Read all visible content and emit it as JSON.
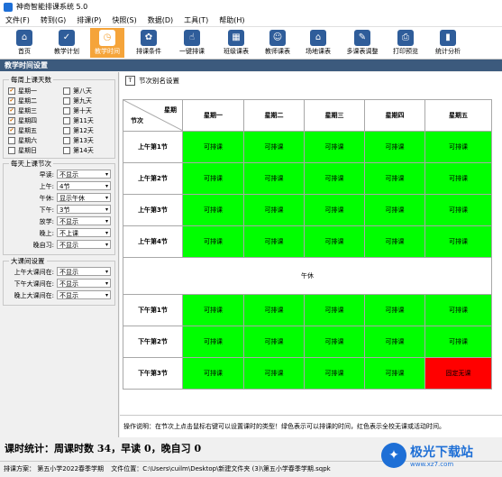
{
  "window": {
    "title": "神奇智能排课系统 5.0"
  },
  "menu": [
    "文件(F)",
    "转到(G)",
    "排课(P)",
    "快照(S)",
    "数据(D)",
    "工具(T)",
    "帮助(H)"
  ],
  "toolbar": [
    {
      "label": "首页",
      "icon": "home-icon",
      "glyph": "⌂"
    },
    {
      "label": "教学计划",
      "icon": "clipboard-icon",
      "glyph": "✓"
    },
    {
      "label": "教学时间",
      "icon": "clock-icon",
      "glyph": "◷",
      "active": true
    },
    {
      "label": "排课条件",
      "icon": "circles-icon",
      "glyph": "✿"
    },
    {
      "label": "一键排课",
      "icon": "hand-icon",
      "glyph": "☝"
    },
    {
      "label": "班级课表",
      "icon": "grid-icon",
      "glyph": "▦"
    },
    {
      "label": "教师课表",
      "icon": "teacher-icon",
      "glyph": "☺"
    },
    {
      "label": "场地课表",
      "icon": "building-icon",
      "glyph": "⌂"
    },
    {
      "label": "多课表调整",
      "icon": "adjust-icon",
      "glyph": "✎"
    },
    {
      "label": "打印预览",
      "icon": "print-icon",
      "glyph": "⎙"
    },
    {
      "label": "统计分析",
      "icon": "chart-icon",
      "glyph": "▮"
    }
  ],
  "section_title": "教学时间设置",
  "days_group": {
    "title": "每周上课天数",
    "left": [
      {
        "label": "星期一",
        "checked": true
      },
      {
        "label": "星期二",
        "checked": true
      },
      {
        "label": "星期三",
        "checked": true
      },
      {
        "label": "星期四",
        "checked": true
      },
      {
        "label": "星期五",
        "checked": true
      },
      {
        "label": "星期六",
        "checked": false
      },
      {
        "label": "星期日",
        "checked": false
      }
    ],
    "right": [
      {
        "label": "第八天",
        "checked": false
      },
      {
        "label": "第九天",
        "checked": false
      },
      {
        "label": "第十天",
        "checked": false
      },
      {
        "label": "第11天",
        "checked": false
      },
      {
        "label": "第12天",
        "checked": false
      },
      {
        "label": "第13天",
        "checked": false
      },
      {
        "label": "第14天",
        "checked": false
      }
    ]
  },
  "periods_group": {
    "title": "每天上课节次",
    "rows": [
      {
        "label": "早读:",
        "value": "不显示"
      },
      {
        "label": "上午:",
        "value": "4节"
      },
      {
        "label": "午休:",
        "value": "显示午休"
      },
      {
        "label": "下午:",
        "value": "3节"
      },
      {
        "label": "放学:",
        "value": "不显示"
      },
      {
        "label": "晚上:",
        "value": "不上课"
      },
      {
        "label": "晚自习:",
        "value": "不显示"
      }
    ]
  },
  "break_group": {
    "title": "大课间设置",
    "rows": [
      {
        "label": "上午大课间在:",
        "value": "不显示"
      },
      {
        "label": "下午大课间在:",
        "value": "不显示"
      },
      {
        "label": "晚上大课间在:",
        "value": "不显示"
      }
    ]
  },
  "subtool": {
    "label": "节次别名设置"
  },
  "schedule": {
    "corner_top": "星期",
    "corner_bottom": "节次",
    "days": [
      "星期一",
      "星期二",
      "星期三",
      "星期四",
      "星期五"
    ],
    "noon_label": "午休",
    "rows_am": [
      {
        "label": "上午第1节",
        "cells": [
          "可排课",
          "可排课",
          "可排课",
          "可排课",
          "可排课"
        ]
      },
      {
        "label": "上午第2节",
        "cells": [
          "可排课",
          "可排课",
          "可排课",
          "可排课",
          "可排课"
        ]
      },
      {
        "label": "上午第3节",
        "cells": [
          "可排课",
          "可排课",
          "可排课",
          "可排课",
          "可排课"
        ]
      },
      {
        "label": "上午第4节",
        "cells": [
          "可排课",
          "可排课",
          "可排课",
          "可排课",
          "可排课"
        ]
      }
    ],
    "rows_pm": [
      {
        "label": "下午第1节",
        "cells": [
          "可排课",
          "可排课",
          "可排课",
          "可排课",
          "可排课"
        ]
      },
      {
        "label": "下午第2节",
        "cells": [
          "可排课",
          "可排课",
          "可排课",
          "可排课",
          "可排课"
        ]
      },
      {
        "label": "下午第3节",
        "cells": [
          "可排课",
          "可排课",
          "可排课",
          "可排课",
          "固定无课"
        ]
      }
    ],
    "colors": {
      "available": "#00ff00",
      "blocked": "#ff0000"
    }
  },
  "hint": "操作说明：在节次上点击鼠标右键可以设置课时的类型！绿色表示可以排课的时间，红色表示全校无课或活动时间。",
  "stats": "课时统计：周课时数 34，早读 0，晚自习 0",
  "status": {
    "plan": "排课方案：  第五小学2022春季学期",
    "file": "文件位置：C:\\Users\\cuilm\\Desktop\\新建文件夹 (3)\\第五小学春季学期.sqpk"
  },
  "watermark": {
    "brand": "极光下载站",
    "url": "www.xz7.com"
  }
}
